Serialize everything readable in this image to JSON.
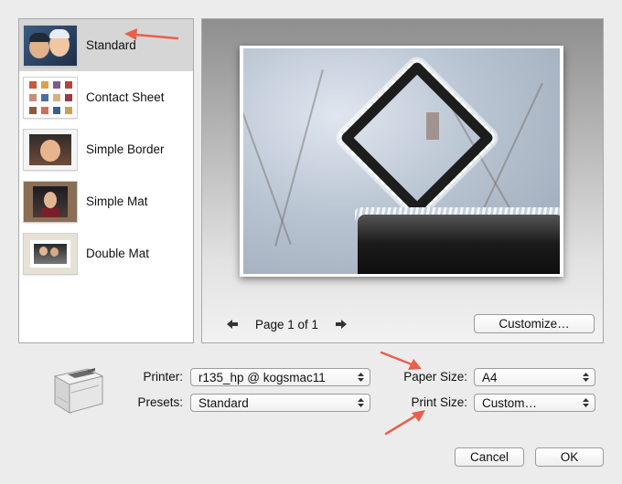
{
  "styles": [
    {
      "label": "Standard",
      "selected": true,
      "thumb": "family-photo"
    },
    {
      "label": "Contact Sheet",
      "selected": false,
      "thumb": "contact-sheet-grid"
    },
    {
      "label": "Simple Border",
      "selected": false,
      "thumb": "baby-photo-border"
    },
    {
      "label": "Simple Mat",
      "selected": false,
      "thumb": "girl-photo-mat"
    },
    {
      "label": "Double Mat",
      "selected": false,
      "thumb": "couple-photo-double-mat"
    }
  ],
  "preview": {
    "page_label": "Page 1 of 1",
    "prev_icon": "arrow-left-icon",
    "next_icon": "arrow-right-icon",
    "customize_label": "Customize…",
    "photo": "frosted-diamond-frame-on-post"
  },
  "printer": {
    "label": "Printer:",
    "value": "r135_hp @ kogsmac11",
    "icon": "laser-printer-icon"
  },
  "presets": {
    "label": "Presets:",
    "value": "Standard"
  },
  "paper_size": {
    "label": "Paper Size:",
    "value": "A4"
  },
  "print_size": {
    "label": "Print Size:",
    "value": "Custom…"
  },
  "buttons": {
    "cancel": "Cancel",
    "ok": "OK"
  },
  "colors": {
    "annotation_arrow": "#e8604c",
    "selected_row": "#d6d6d6"
  }
}
